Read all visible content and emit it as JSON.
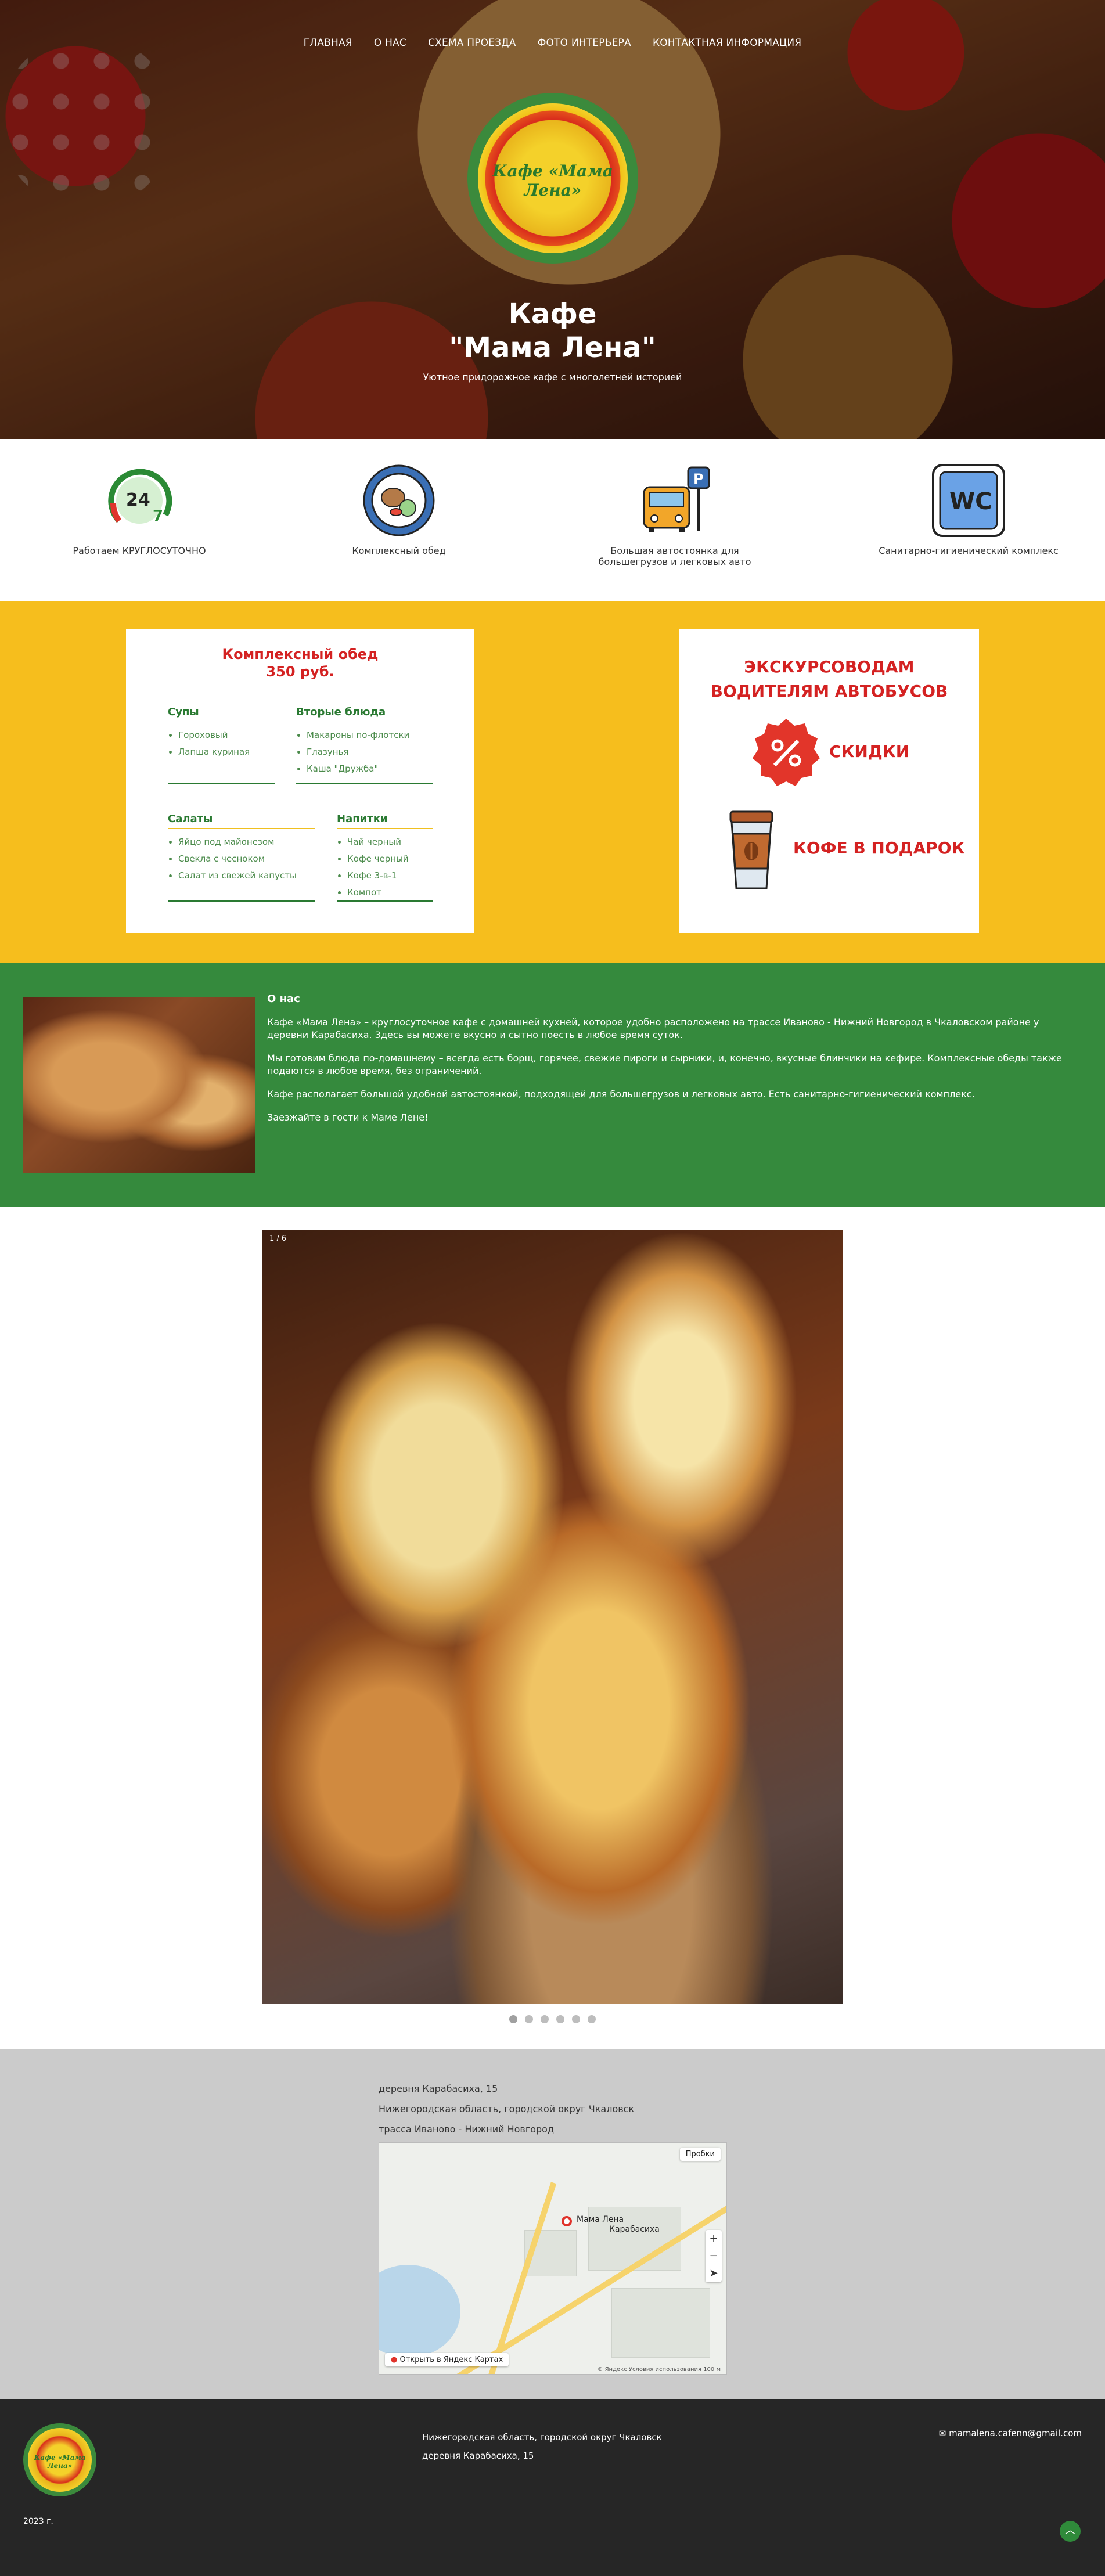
{
  "nav": [
    "ГЛАВНАЯ",
    "О НАС",
    "СХЕМА ПРОЕЗДА",
    "ФОТО ИНТЕРЬЕРА",
    "КОНТАКТНАЯ ИНФОРМАЦИЯ"
  ],
  "hero": {
    "logo_text": "Кафе «Мама Лена»",
    "title_line1": "Кафе",
    "title_line2": "\"Мама Лена\"",
    "subtitle": "Уютное придорожное кафе с многолетней историей"
  },
  "features": [
    {
      "icon": "24-7-icon",
      "label": "Работаем КРУГЛОСУТОЧНО"
    },
    {
      "icon": "lunch-plate-icon",
      "label": "Комплексный обед"
    },
    {
      "icon": "bus-parking-icon",
      "label": "Большая автостоянка для большегрузов и легковых авто"
    },
    {
      "icon": "wc-icon",
      "label": "Санитарно-гигиенический комплекс"
    }
  ],
  "menu": {
    "title": "Комплексный обед",
    "price": "350 руб.",
    "columns": [
      {
        "heading": "Супы",
        "items": [
          "Гороховый",
          "Лапша куриная"
        ]
      },
      {
        "heading": "Вторые блюда",
        "items": [
          "Макароны по-флотски",
          "Глазунья",
          "Каша \"Дружба\""
        ]
      },
      {
        "heading": "Салаты",
        "items": [
          "Яйцо под майонезом",
          "Свекла с чесноком",
          "Салат из свежей капусты"
        ]
      },
      {
        "heading": "Напитки",
        "items": [
          "Чай черный",
          "Кофе черный",
          "Кофе 3-в-1",
          "Компот"
        ]
      }
    ]
  },
  "promo": {
    "title_line1": "ЭКСКУРСОВОДАМ",
    "title_line2": "ВОДИТЕЛЯМ АВТОБУСОВ",
    "discount_label": "СКИДКИ",
    "coffee_label": "КОФЕ В ПОДАРОК",
    "discount_icon": "percent-badge-icon",
    "coffee_icon": "coffee-cup-icon"
  },
  "about": {
    "heading": "О нас",
    "paragraphs": [
      "Кафе «Мама Лена» – круглосуточное кафе с домашней кухней, которое удобно расположено на трассе Иваново - Нижний Новгород в Чкаловском районе у деревни Карабасиха. Здесь вы можете вкусно и сытно поесть в любое время суток.",
      "Мы готовим блюда по-домашнему – всегда есть борщ, горячее, свежие пироги и сырники, и, конечно, вкусные блинчики на кефире. Комплексные обеды также подаются в любое время, без ограничений.",
      "Кафе располагает большой удобной автостоянкой, подходящей для большегрузов и легковых авто. Есть санитарно-гигиенический комплекс.",
      "Заезжайте в гости к Маме Лене!"
    ]
  },
  "gallery": {
    "counter": "1 / 6",
    "dots": 6,
    "active": 1
  },
  "address": {
    "line1": "деревня Карабасиха, 15",
    "line2": "Нижегородская область, городской округ Чкаловск",
    "line3": "трасса Иваново - Нижний Новгород"
  },
  "map": {
    "traffic": "Пробки",
    "pin_label1": "Мама Лена",
    "pin_label2": "Карабасиха",
    "open_label": "Открыть в Яндекс Картах",
    "copyright": "© Яндекс   Условия использования   100 м"
  },
  "footer": {
    "logo_text": "Кафе «Мама Лена»",
    "addr1": "Нижегородская область, городской округ Чкаловск",
    "addr2": "деревня Карабасиха, 15",
    "email": "mamalena.cafenn@gmail.com",
    "year": "2023 г.",
    "up_icon": "arrow-up-icon"
  },
  "colors": {
    "green": "#358a3d",
    "yellow": "#f6be1d",
    "red": "#d42222",
    "footer": "#262626",
    "address_bg": "#cbcbcb"
  }
}
